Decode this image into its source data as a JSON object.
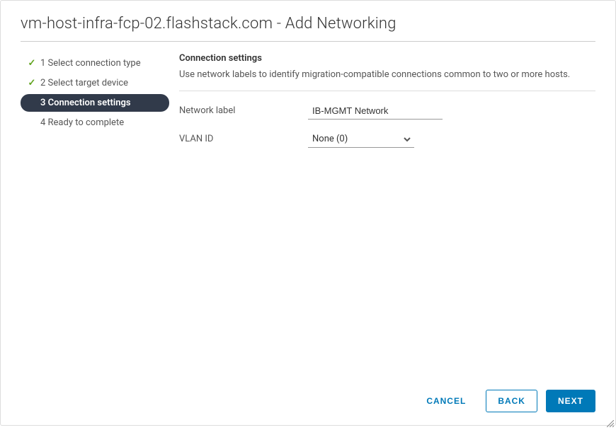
{
  "header": {
    "title": "vm-host-infra-fcp-02.flashstack.com - Add Networking"
  },
  "wizard": {
    "steps": [
      {
        "label": "1 Select connection type",
        "state": "done"
      },
      {
        "label": "2 Select target device",
        "state": "done"
      },
      {
        "label": "3 Connection settings",
        "state": "active"
      },
      {
        "label": "4 Ready to complete",
        "state": "pending"
      }
    ]
  },
  "content": {
    "heading": "Connection settings",
    "description": "Use network labels to identify migration-compatible connections common to two or more hosts.",
    "network_label_field": "Network label",
    "network_label_value": "IB-MGMT Network",
    "vlan_id_field": "VLAN ID",
    "vlan_id_value": "None (0)"
  },
  "footer": {
    "cancel": "CANCEL",
    "back": "BACK",
    "next": "NEXT"
  }
}
